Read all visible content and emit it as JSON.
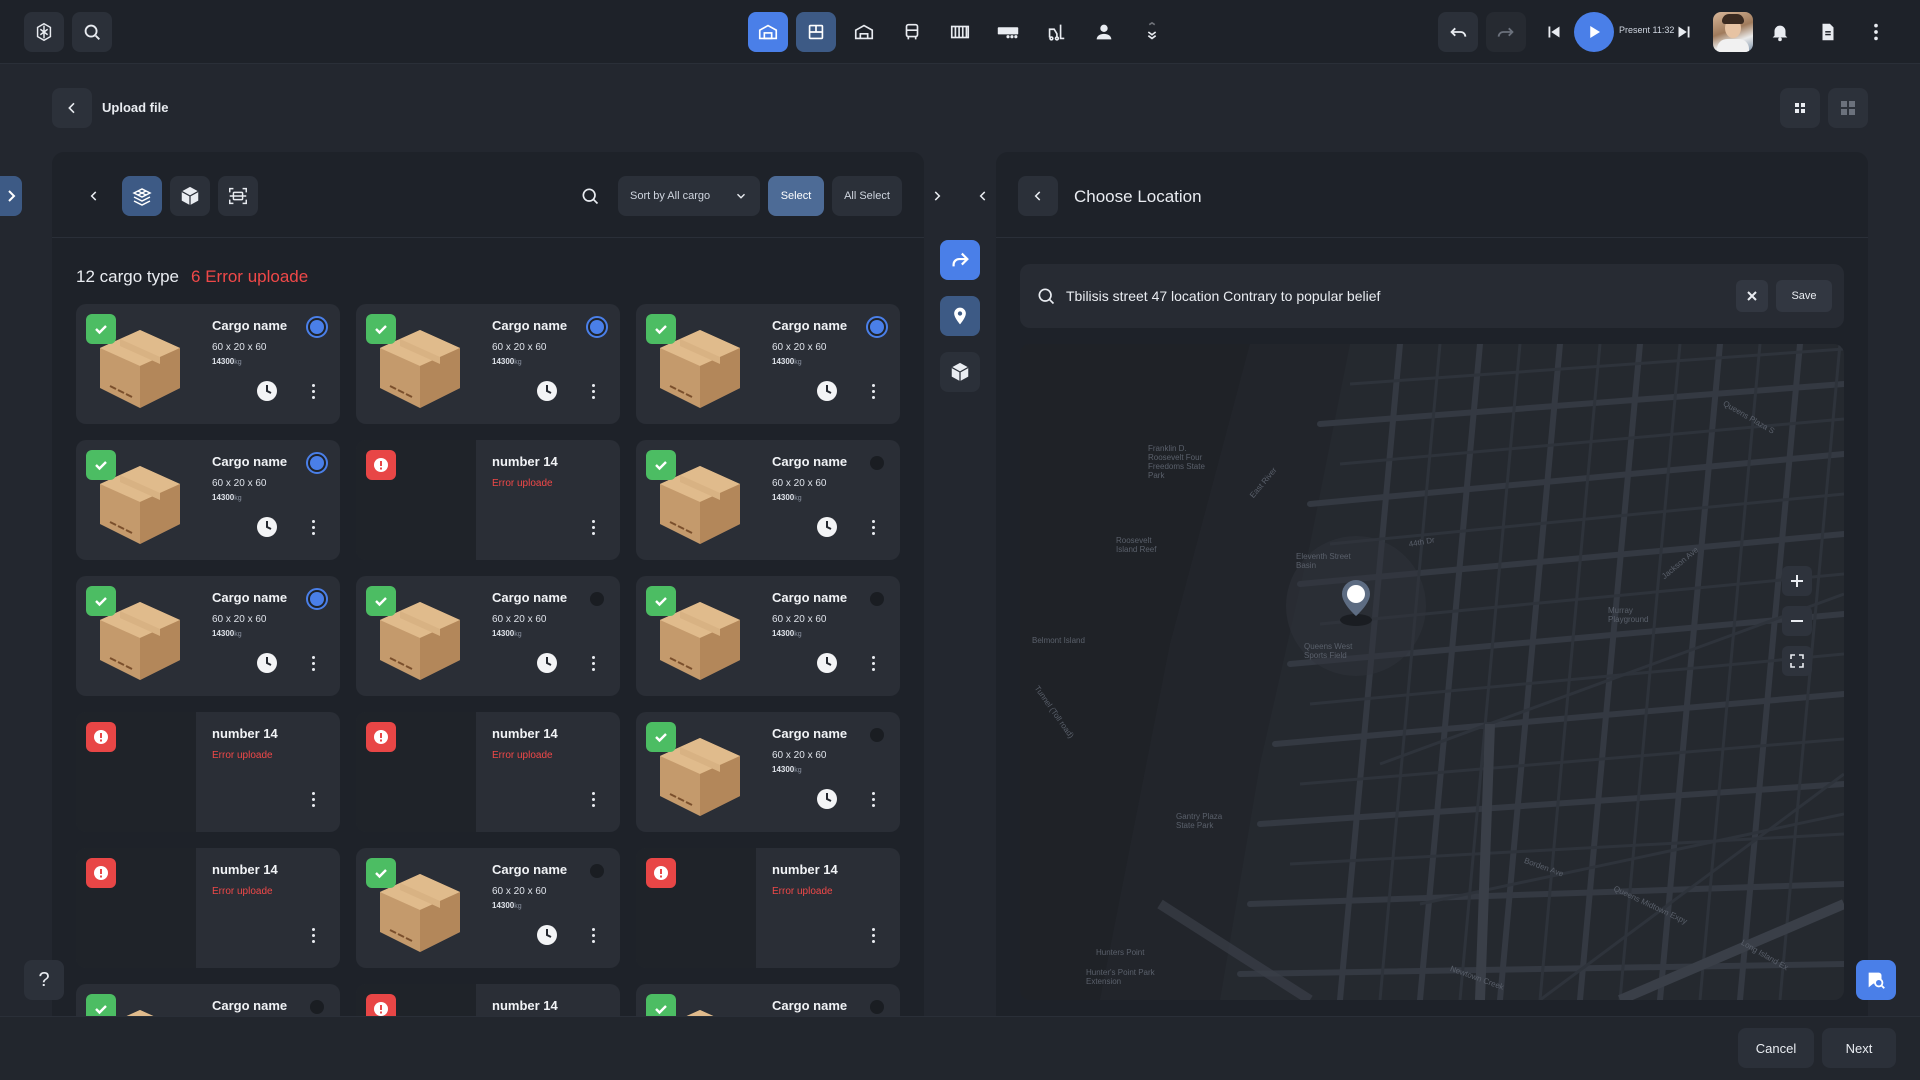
{
  "topbar": {
    "present_label": "Present 11:32",
    "accent": "#4a7fe8"
  },
  "header": {
    "title": "Upload file"
  },
  "cargo_panel": {
    "sort_label": "Sort by All cargo",
    "select_label": "Select",
    "all_select_label": "All Select",
    "summary": {
      "count_text": "12 cargo type",
      "error_text": "6 Error uploade"
    },
    "cards": [
      {
        "status": "ok",
        "title": "Cargo name",
        "dims": "60 x 20 x 60",
        "weight": "14300",
        "unit": "kg",
        "selected": true
      },
      {
        "status": "ok",
        "title": "Cargo name",
        "dims": "60 x 20 x 60",
        "weight": "14300",
        "unit": "kg",
        "selected": true
      },
      {
        "status": "ok",
        "title": "Cargo name",
        "dims": "60 x 20 x 60",
        "weight": "14300",
        "unit": "kg",
        "selected": true
      },
      {
        "status": "ok",
        "title": "Cargo name",
        "dims": "60 x 20 x 60",
        "weight": "14300",
        "unit": "kg",
        "selected": true
      },
      {
        "status": "error",
        "title": "number 14",
        "error_text": "Error uploade"
      },
      {
        "status": "ok",
        "title": "Cargo name",
        "dims": "60 x 20 x 60",
        "weight": "14300",
        "unit": "kg",
        "selected": false
      },
      {
        "status": "ok",
        "title": "Cargo name",
        "dims": "60 x 20 x 60",
        "weight": "14300",
        "unit": "kg",
        "selected": true
      },
      {
        "status": "ok",
        "title": "Cargo name",
        "dims": "60 x 20 x 60",
        "weight": "14300",
        "unit": "kg",
        "selected": false
      },
      {
        "status": "ok",
        "title": "Cargo name",
        "dims": "60 x 20 x 60",
        "weight": "14300",
        "unit": "kg",
        "selected": false
      },
      {
        "status": "error",
        "title": "number 14",
        "error_text": "Error uploade"
      },
      {
        "status": "error",
        "title": "number 14",
        "error_text": "Error uploade"
      },
      {
        "status": "ok",
        "title": "Cargo name",
        "dims": "60 x 20 x 60",
        "weight": "14300",
        "unit": "kg",
        "selected": false
      },
      {
        "status": "error",
        "title": "number 14",
        "error_text": "Error uploade"
      },
      {
        "status": "ok",
        "title": "Cargo name",
        "dims": "60 x 20 x 60",
        "weight": "14300",
        "unit": "kg",
        "selected": false
      },
      {
        "status": "error",
        "title": "number 14",
        "error_text": "Error uploade"
      },
      {
        "status": "ok",
        "title": "Cargo name",
        "selected": false,
        "partial": true
      },
      {
        "status": "error",
        "title": "number 14",
        "partial": true
      },
      {
        "status": "ok",
        "title": "Cargo name",
        "selected": false,
        "partial": true
      }
    ]
  },
  "location_panel": {
    "title": "Choose Location",
    "search_value": "Tbilisis street  47 location Contrary to popular belief",
    "save_label": "Save",
    "map_labels": [
      "Franklin D. Roosevelt Four Freedoms State Park",
      "Roosevelt Island Reef",
      "Belmont Island",
      "Queens West Sports Field",
      "Murray Playground",
      "Gantry Plaza State Park",
      "Hunters Point",
      "Hunter's Point Park Extension",
      "Newtown Creek",
      "Queens Midtown Expy",
      "Jackson Ave",
      "Borden Ave",
      "Long Island Ex",
      "44th Dr",
      "Eleventh Street Basin",
      "East River",
      "Tunnel (Toll road)",
      "Queens Plaza S"
    ]
  },
  "footer": {
    "cancel_label": "Cancel",
    "next_label": "Next",
    "help_label": "?"
  }
}
